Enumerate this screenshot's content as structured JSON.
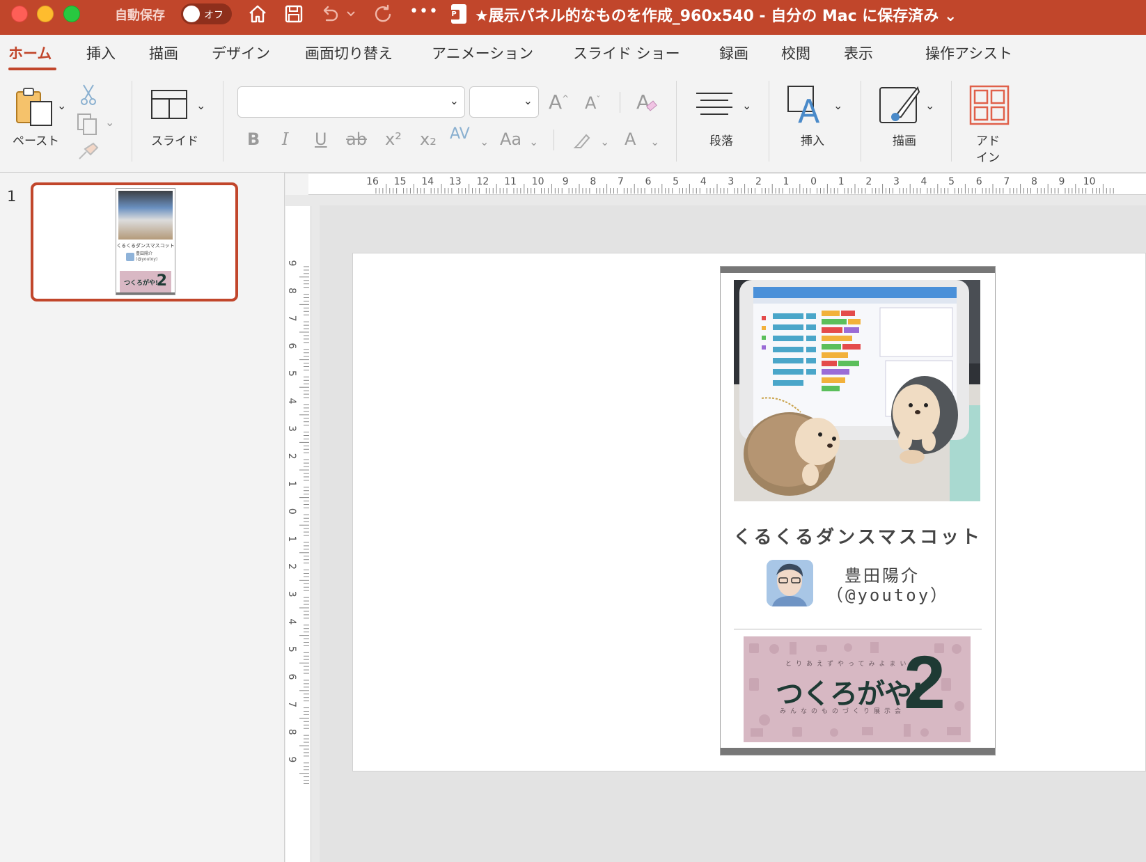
{
  "window": {
    "autosave_label": "自動保存",
    "autosave_state": "オフ",
    "title": "★展示パネル的なものを作成_960x540 - 自分の Mac に保存済み ⌄",
    "app_icon_letter": "P",
    "more_label": "•••"
  },
  "tabs": [
    "ホーム",
    "挿入",
    "描画",
    "デザイン",
    "画面切り替え",
    "アニメーション",
    "スライド ショー",
    "録画",
    "校閲",
    "表示",
    "操作アシスト"
  ],
  "ribbon": {
    "paste_label": "ペースト",
    "slide_label": "スライド",
    "font_name": "",
    "font_size": "",
    "paragraph_label": "段落",
    "insert_label": "挿入",
    "draw_label": "描画",
    "addin_label_1": "アド",
    "addin_label_2": "イン",
    "bold": "B",
    "italic": "I",
    "underline": "U",
    "strike": "ab",
    "superscript": "x²",
    "subscript": "x₂",
    "spacing": "AV",
    "case": "Aa",
    "font_color": "A",
    "grow": "A",
    "shrink": "A"
  },
  "thumbnails": {
    "slide_number": "1",
    "mini_title": "くるくるダンスマスコット",
    "mini_name": "豊田陽介",
    "mini_handle": "(@youtoy)",
    "mini_banner_text": "つくろがや!",
    "mini_banner_num": "2"
  },
  "hruler_labels": [
    "16",
    "15",
    "14",
    "13",
    "12",
    "11",
    "10",
    "9",
    "8",
    "7",
    "6",
    "5",
    "4",
    "3",
    "2",
    "1",
    "0",
    "1",
    "2",
    "3",
    "4",
    "5",
    "6",
    "7",
    "8",
    "9",
    "10"
  ],
  "vruler_labels": [
    "9",
    "8",
    "7",
    "6",
    "5",
    "4",
    "3",
    "2",
    "1",
    "0",
    "1",
    "2",
    "3",
    "4",
    "5",
    "6",
    "7",
    "8",
    "9"
  ],
  "slide": {
    "title": "くるくるダンスマスコット",
    "author_name": "豊田陽介",
    "author_handle": "（@youtoy）",
    "banner_sub": "とりあえずやってみよまい",
    "banner_main": "つくろがや!",
    "banner_num": "2",
    "banner_cap": "みんなのものづくり展示会"
  },
  "colors": {
    "accent": "#c1462b",
    "banner_bg": "#d7b8c3",
    "banner_ink": "#1e3a34"
  }
}
